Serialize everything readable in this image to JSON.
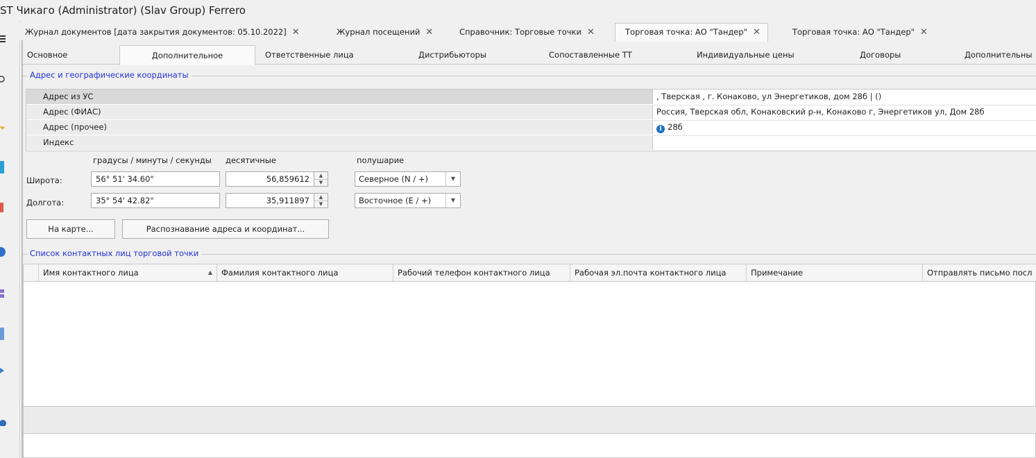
{
  "window": {
    "title": "ST Чикаго (Administrator) (Slav Group) Ferrero"
  },
  "document_tabs": [
    {
      "label": "Журнал документов [дата закрытия документов: 05.10.2022]",
      "close": "✕"
    },
    {
      "label": "Журнал посещений",
      "close": "✕"
    },
    {
      "label": "Справочник: Торговые точки",
      "close": "✕"
    },
    {
      "label": "Торговая точка: АО \"Тандер\"",
      "close": "✕",
      "active": true
    },
    {
      "label": "Торговая точка: АО \"Тандер\"",
      "close": "✕"
    }
  ],
  "sub_tabs": [
    {
      "label": "Основное"
    },
    {
      "label": "Дополнительное",
      "active": true
    },
    {
      "label": "Ответственные лица"
    },
    {
      "label": "Дистрибьюторы"
    },
    {
      "label": "Сопоставленные ТТ"
    },
    {
      "label": "Индивидуальные цены"
    },
    {
      "label": "Договоры"
    },
    {
      "label": "Дополнительны"
    }
  ],
  "address_group": {
    "caption": "Адрес и географические координаты",
    "rows": [
      {
        "label": "Адрес из УС",
        "value": ", Тверская , г. Конаково, ул Энергетиков, дом 28б | ()"
      },
      {
        "label": "Адрес (ФИАС)",
        "value": "Россия, Тверская обл, Конаковский р-н, Конаково г, Энергетиков ул, Дом 28б"
      },
      {
        "label": "Адрес (прочее)",
        "value": "28б",
        "icon": "info-icon"
      },
      {
        "label": "Индекс",
        "value": ""
      }
    ]
  },
  "coords": {
    "dms_header": "градусы / минуты / секунды",
    "decimal_header": "десятичные",
    "hemisphere_header": "полушарие",
    "latitude": {
      "label": "Широта:",
      "dms": "56° 51' 34.60\"",
      "decimal": "56,859612",
      "hemisphere": "Северное (N / +)"
    },
    "longitude": {
      "label": "Долгота:",
      "dms": "35° 54' 42.82\"",
      "decimal": "35,911897",
      "hemisphere": "Восточное (E / +)"
    }
  },
  "buttons": {
    "map": "На карте...",
    "recognize": "Распознавание адреса и координат..."
  },
  "contacts_group": {
    "caption": "Список контактных лиц торговой точки",
    "columns": [
      "Имя контактного лица",
      "Фамилия контактного лица",
      "Рабочий телефон контактного лица",
      "Рабочая эл.почта контактного лица",
      "Примечание",
      "Отправлять письмо посл"
    ],
    "sort_indicator": "▲"
  },
  "colors": {
    "group_caption": "#2032d8",
    "info_icon": "#1f6fc1"
  }
}
